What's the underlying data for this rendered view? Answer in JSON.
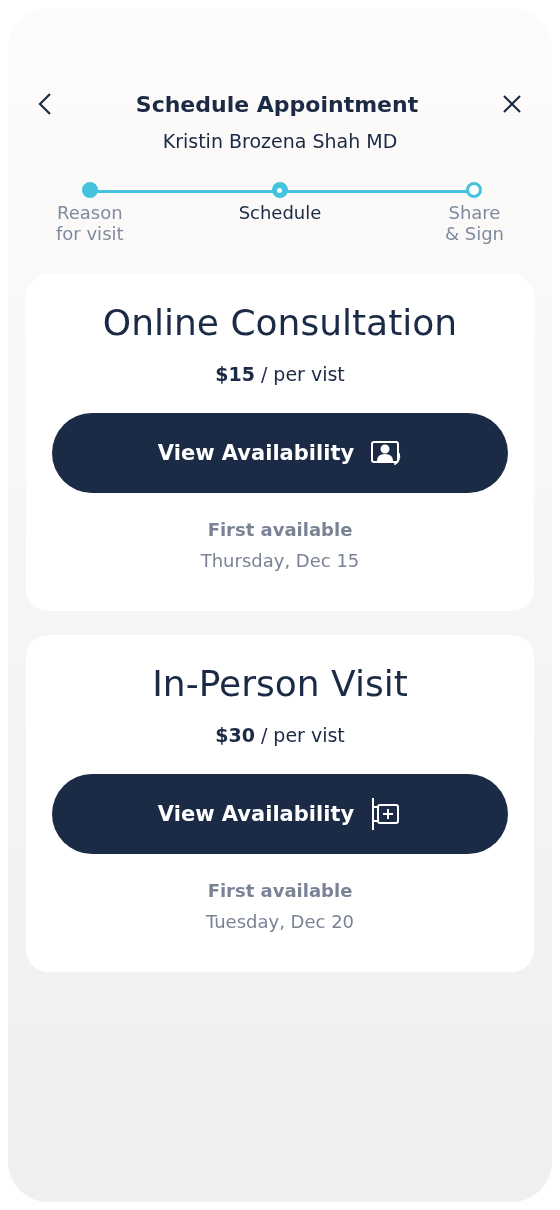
{
  "header": {
    "title": "Schedule Appointment",
    "subtitle": "Kristin Brozena Shah MD"
  },
  "steps": [
    {
      "label": "Reason\nfor visit",
      "completed": true,
      "selected": false
    },
    {
      "label": "Schedule",
      "completed": false,
      "selected": true
    },
    {
      "label": "Share\n& Sign",
      "completed": false,
      "selected": false
    }
  ],
  "options": [
    {
      "title": "Online Consultation",
      "price": "**$15** / per vist",
      "button": "View Availability",
      "kind": "video",
      "first_label": "First available",
      "first_date": "Thursday, Dec 15"
    },
    {
      "title": "In-Person Visit",
      "price": "**$30** / per vist",
      "button": "View Availability",
      "kind": "clinic",
      "first_label": "First available",
      "first_date": "Tuesday, Dec 20"
    }
  ]
}
